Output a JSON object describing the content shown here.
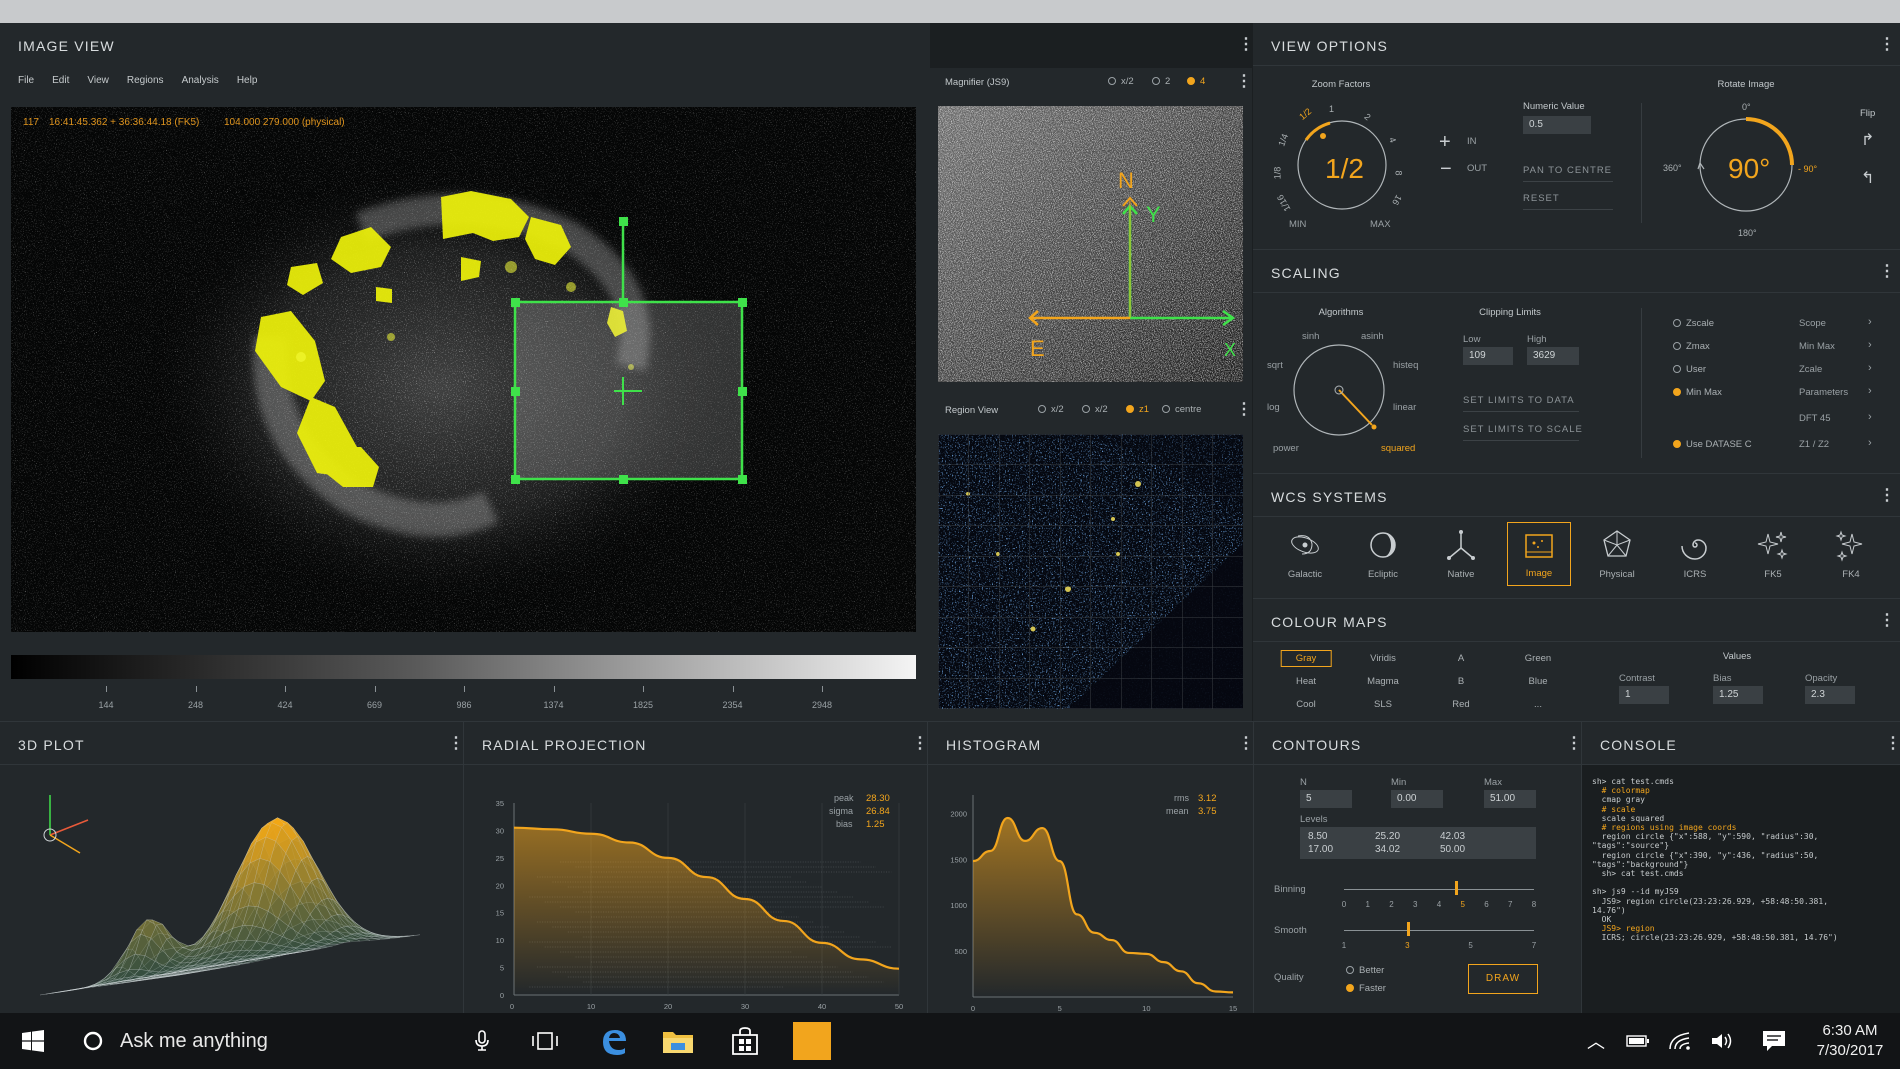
{
  "image_view": {
    "title": "IMAGE VIEW",
    "menu": [
      "File",
      "Edit",
      "View",
      "Regions",
      "Analysis",
      "Help"
    ],
    "coord_frame": "117",
    "coord_wcs": "16:41:45.362 + 36:36:44.18 (FK5)",
    "coord_physical": "104.000  279.000 (physical)",
    "colorbar_ticks": [
      "144",
      "248",
      "424",
      "669",
      "986",
      "1374",
      "1825",
      "2354",
      "2948"
    ]
  },
  "magnifier": {
    "title": "Magnifier (JS9)",
    "options": [
      "x/2",
      "2",
      "4"
    ],
    "selected": "4",
    "north": "N",
    "east": "E",
    "y_axis": "Y",
    "x_axis": "X"
  },
  "region_view": {
    "title": "Region View",
    "options": [
      "x/2",
      "x/2",
      "z1",
      "centre"
    ],
    "selected": "z1"
  },
  "view_options": {
    "title": "VIEW OPTIONS",
    "zoom_label": "Zoom Factors",
    "zoom_value": "1/2",
    "zoom_min": "MIN",
    "zoom_max": "MAX",
    "zoom_ticks": [
      "1/8",
      "1/4",
      "1/2",
      "1",
      "2",
      "4",
      "8",
      "16",
      "1/16"
    ],
    "zoom_in": "IN",
    "zoom_out": "OUT",
    "numeric_label": "Numeric Value",
    "numeric_value": "0.5",
    "pan": "PAN TO CENTRE",
    "reset": "RESET",
    "rotate_label": "Rotate Image",
    "rotate_value": "90°",
    "rotate_top": "0°",
    "rotate_left": "360°",
    "rotate_right": "- 90°",
    "rotate_bottom": "180°",
    "flip": "Flip"
  },
  "scaling": {
    "title": "SCALING",
    "algorithms_label": "Algorithms",
    "algorithms": [
      "sinh",
      "asinh",
      "sqrt",
      "histeq",
      "log",
      "linear",
      "power",
      "squared"
    ],
    "selected_algorithm": "squared",
    "clip_label": "Clipping Limits",
    "low_label": "Low",
    "low_value": "109",
    "high_label": "High",
    "high_value": "3629",
    "set_data": "SET LIMITS TO DATA",
    "set_scale": "SET LIMITS TO SCALE",
    "limits": [
      "Zscale",
      "Zmax",
      "User",
      "Min Max"
    ],
    "selected_limit": "Min Max",
    "use_datasec": "Use DATASE C",
    "scope_items": [
      "Scope",
      "Min Max",
      "Zcale",
      "Parameters",
      "DFT 45",
      "Z1 / Z2"
    ]
  },
  "wcs": {
    "title": "WCS SYSTEMS",
    "items": [
      "Galactic",
      "Ecliptic",
      "Native",
      "Image",
      "Physical",
      "ICRS",
      "FK5",
      "FK4"
    ],
    "selected": "Image"
  },
  "colour_maps": {
    "title": "COLOUR MAPS",
    "maps": [
      [
        "Gray",
        "Viridis",
        "A",
        "Green"
      ],
      [
        "Heat",
        "Magma",
        "B",
        "Blue"
      ],
      [
        "Cool",
        "SLS",
        "Red",
        "..."
      ]
    ],
    "selected": "Gray",
    "values_label": "Values",
    "contrast_label": "Contrast",
    "contrast": "1",
    "bias_label": "Bias",
    "bias": "1.25",
    "opacity_label": "Opacity",
    "opacity": "2.3"
  },
  "plot3d": {
    "title": "3D PLOT"
  },
  "radial": {
    "title": "RADIAL PROJECTION",
    "peak_label": "peak",
    "peak": "28.30",
    "sigma_label": "sigma",
    "sigma": "26.84",
    "bias_label": "bias",
    "bias": "1.25"
  },
  "histogram": {
    "title": "HISTOGRAM",
    "rms_label": "rms",
    "rms": "3.12",
    "mean_label": "mean",
    "mean": "3.75"
  },
  "contours": {
    "title": "CONTOURS",
    "n_label": "N",
    "n": "5",
    "min_label": "Min",
    "min": "0.00",
    "max_label": "Max",
    "max": "51.00",
    "levels_label": "Levels",
    "levels": [
      [
        "8.50",
        "25.20",
        "42.03"
      ],
      [
        "17.00",
        "34.02",
        "50.00"
      ]
    ],
    "binning_label": "Binning",
    "binning_ticks": [
      "0",
      "1",
      "2",
      "3",
      "4",
      "5",
      "6",
      "7",
      "8"
    ],
    "binning": 5,
    "smooth_label": "Smooth",
    "smooth_ticks": [
      "1",
      "3",
      "5",
      "7"
    ],
    "smooth": 3,
    "quality_label": "Quality",
    "quality": [
      "Better",
      "Faster"
    ],
    "quality_selected": "Faster",
    "draw": "DRAW"
  },
  "console": {
    "title": "CONSOLE",
    "lines": [
      [
        "sh> cat test.cmds",
        ""
      ],
      [
        "  # colormap",
        "c"
      ],
      [
        "  cmap gray",
        ""
      ],
      [
        "  # scale",
        "c"
      ],
      [
        "  scale squared",
        ""
      ],
      [
        "  # regions using image coords",
        "c"
      ],
      [
        "  region circle {\"x\":588, \"y\":590, \"radius\":30,",
        ""
      ],
      [
        "\"tags\":\"source\"}",
        ""
      ],
      [
        "  region circle {\"x\":390, \"y\":436, \"radius\":50,",
        ""
      ],
      [
        "\"tags\":\"background\"}",
        ""
      ],
      [
        "  sh> cat test.cmds",
        ""
      ],
      [
        "",
        ""
      ],
      [
        "sh> js9 --id myJS9",
        ""
      ],
      [
        "  JS9> region circle(23:23:26.929, +58:48:50.381,",
        ""
      ],
      [
        "14.76\")",
        ""
      ],
      [
        "  OK",
        ""
      ],
      [
        "  JS9> region",
        "c"
      ],
      [
        "  ICRS; circle(23:23:26.929, +58:48:50.381, 14.76\")",
        ""
      ]
    ]
  },
  "charts": {
    "radial_axes": {
      "y": [
        "35",
        "30",
        "25",
        "20",
        "15",
        "10",
        "5",
        "0"
      ],
      "x": [
        "10",
        "20",
        "30",
        "40",
        "50"
      ]
    },
    "hist_axes": {
      "y": [
        "2000",
        "1500",
        "1000",
        "500"
      ],
      "x": [
        "0",
        "5",
        "10",
        "15"
      ]
    }
  },
  "chart_data": [
    {
      "type": "area",
      "title": "",
      "x": [
        0,
        5,
        10,
        15,
        20,
        25,
        30,
        35,
        40,
        45,
        50
      ],
      "y": [
        30.5,
        30.2,
        29.4,
        27.8,
        25.0,
        21.5,
        17.5,
        13.5,
        9.5,
        6.5,
        4.8
      ],
      "ylim": [
        0,
        35
      ],
      "xlim": [
        0,
        50
      ]
    },
    {
      "type": "area",
      "title": "",
      "x": [
        0,
        1,
        2,
        3,
        4,
        5,
        6,
        7,
        8,
        9,
        10,
        11,
        12,
        13,
        14,
        15
      ],
      "y": [
        1480,
        1590,
        1950,
        1700,
        1840,
        1480,
        900,
        700,
        620,
        480,
        470,
        380,
        280,
        150,
        60,
        50
      ],
      "ylim": [
        0,
        2200
      ],
      "xlim": [
        0,
        15
      ]
    }
  ],
  "taskbar": {
    "search": "Ask me anything",
    "time": "6:30 AM",
    "date": "7/30/2017"
  }
}
